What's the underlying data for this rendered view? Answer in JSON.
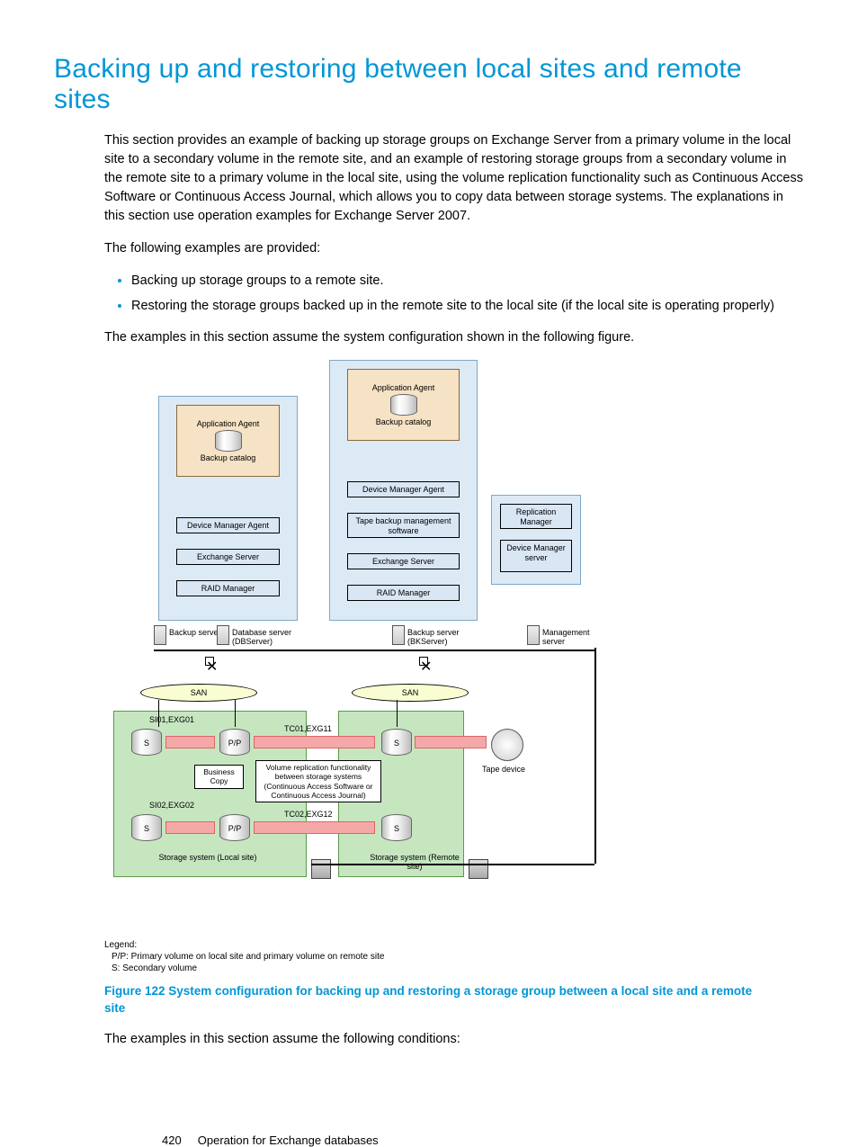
{
  "heading": "Backing up and restoring between local sites and remote sites",
  "para1": "This section provides an example of backing up storage groups on Exchange Server from a primary volume in the local site to a secondary volume in the remote site, and an example of restoring storage groups from a secondary volume in the remote site to a primary volume in the local site, using the volume replication functionality such as Continuous Access Software or Continuous Access Journal, which allows you to copy data between storage systems. The explanations in this section use operation examples for Exchange Server 2007.",
  "para2": "The following examples are provided:",
  "bullets": [
    "Backing up storage groups to a remote site.",
    "Restoring the storage groups backed up in the remote site to the local site (if the local site is operating properly)"
  ],
  "para3": "The examples in this section assume the system configuration shown in the following figure.",
  "figureCaption": "Figure 122 System configuration for backing up and restoring a storage group between a local site and a remote site",
  "para4": "The examples in this section assume the following conditions:",
  "pageNum": "420",
  "footerTitle": "Operation for Exchange databases",
  "diagram": {
    "appAgent": "Application Agent",
    "backupCatalog": "Backup catalog",
    "devMgrAgent": "Device Manager Agent",
    "exchangeServer": "Exchange Server",
    "raidManager": "RAID Manager",
    "tapeBackupSw": "Tape backup management software",
    "replicationMgr": "Replication Manager",
    "devMgrServer": "Device Manager server",
    "backupServerLeft": "Backup server",
    "dbServer": "Database server (DBServer)",
    "bkServer": "Backup server (BKServer)",
    "mgmtServer": "Management server",
    "san": "SAN",
    "si01": "SI01,EXG01",
    "si02": "SI02,EXG02",
    "tc01": "TC01,EXG11",
    "tc02": "TC02,EXG12",
    "businessCopy": "Business Copy",
    "volRepl": "Volume replication functionality between storage systems (Continuous Access Software or Continuous Access Journal)",
    "storageLocal": "Storage system (Local site)",
    "storageRemote": "Storage system (Remote site)",
    "tapeDevice": "Tape device",
    "s": "S",
    "pp": "P/P",
    "legendTitle": "Legend:",
    "legendPP": "P/P: Primary volume on local site and primary volume on remote site",
    "legendS": "S: Secondary volume"
  }
}
